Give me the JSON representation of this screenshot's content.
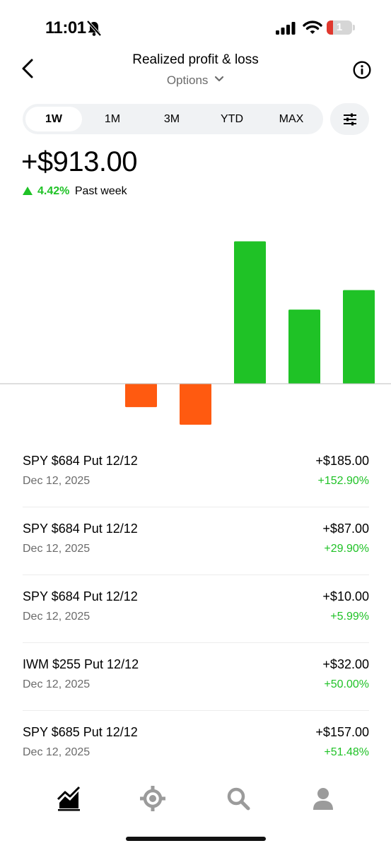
{
  "status_bar": {
    "time": "11:01",
    "battery": "1"
  },
  "header": {
    "title": "Realized profit & loss",
    "subtitle": "Options"
  },
  "tabs": [
    {
      "label": "1W",
      "active": true
    },
    {
      "label": "1M",
      "active": false
    },
    {
      "label": "3M",
      "active": false
    },
    {
      "label": "YTD",
      "active": false
    },
    {
      "label": "MAX",
      "active": false
    }
  ],
  "summary": {
    "value": "+$913.00",
    "change_pct": "4.42%",
    "period": "Past week"
  },
  "colors": {
    "positive": "#1fc226",
    "negative": "#ff5a10",
    "baseline": "#bdbdbd"
  },
  "chart_data": {
    "type": "bar",
    "categories": [
      "1",
      "2",
      "3",
      "4",
      "5",
      "6",
      "7"
    ],
    "values": [
      0,
      0,
      -60,
      -105,
      365,
      190,
      240
    ],
    "grid": false,
    "baseline": 0
  },
  "transactions": [
    {
      "name": "SPY $684 Put 12/12",
      "date": "Dec 12, 2025",
      "amount": "+$185.00",
      "pct": "+152.90%"
    },
    {
      "name": "SPY $684 Put 12/12",
      "date": "Dec 12, 2025",
      "amount": "+$87.00",
      "pct": "+29.90%"
    },
    {
      "name": "SPY $684 Put 12/12",
      "date": "Dec 12, 2025",
      "amount": "+$10.00",
      "pct": "+5.99%"
    },
    {
      "name": "IWM $255 Put 12/12",
      "date": "Dec 12, 2025",
      "amount": "+$32.00",
      "pct": "+50.00%"
    },
    {
      "name": "SPY $685 Put 12/12",
      "date": "Dec 12, 2025",
      "amount": "+$157.00",
      "pct": "+51.48%"
    }
  ],
  "nav": [
    {
      "icon": "investing-chart-icon",
      "active": true
    },
    {
      "icon": "crypto-icon",
      "active": false
    },
    {
      "icon": "search-icon",
      "active": false
    },
    {
      "icon": "account-icon",
      "active": false
    }
  ]
}
